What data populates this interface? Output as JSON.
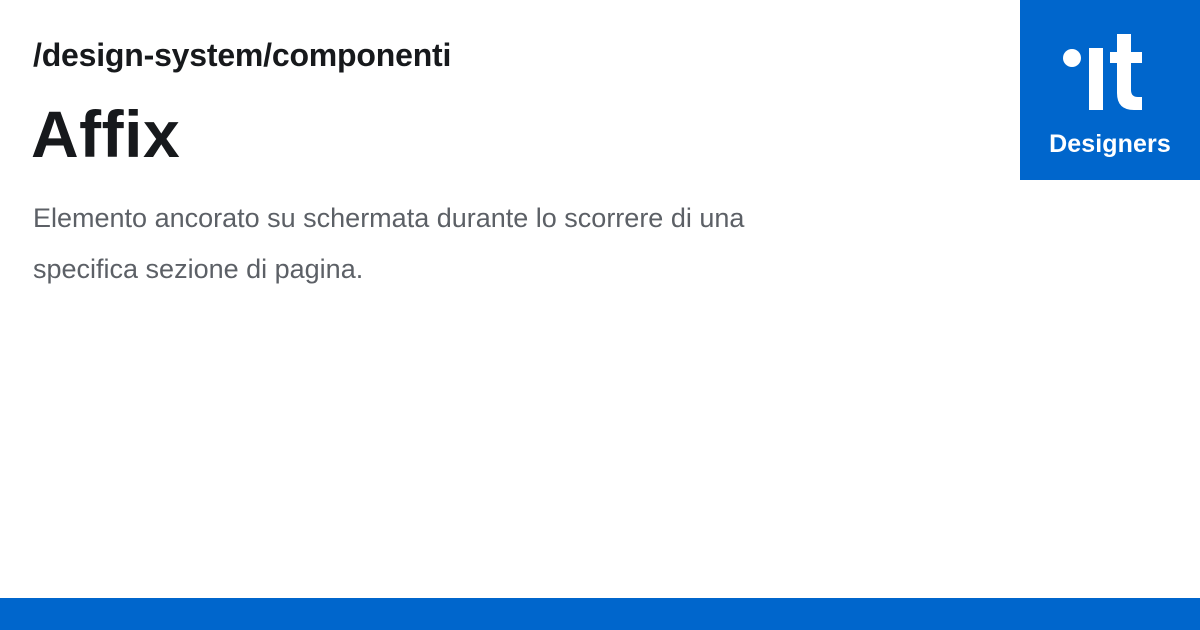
{
  "breadcrumb": "/design-system/componenti",
  "title": "Affix",
  "description": "Elemento ancorato su schermata durante lo scorrere di una specifica sezione di pagina.",
  "logo": {
    "icon": "italia-dot-it-icon",
    "label": "Designers"
  },
  "colors": {
    "brand": "#0066cc",
    "heading": "#17191c",
    "body_text": "#5c6066",
    "background": "#ffffff"
  }
}
